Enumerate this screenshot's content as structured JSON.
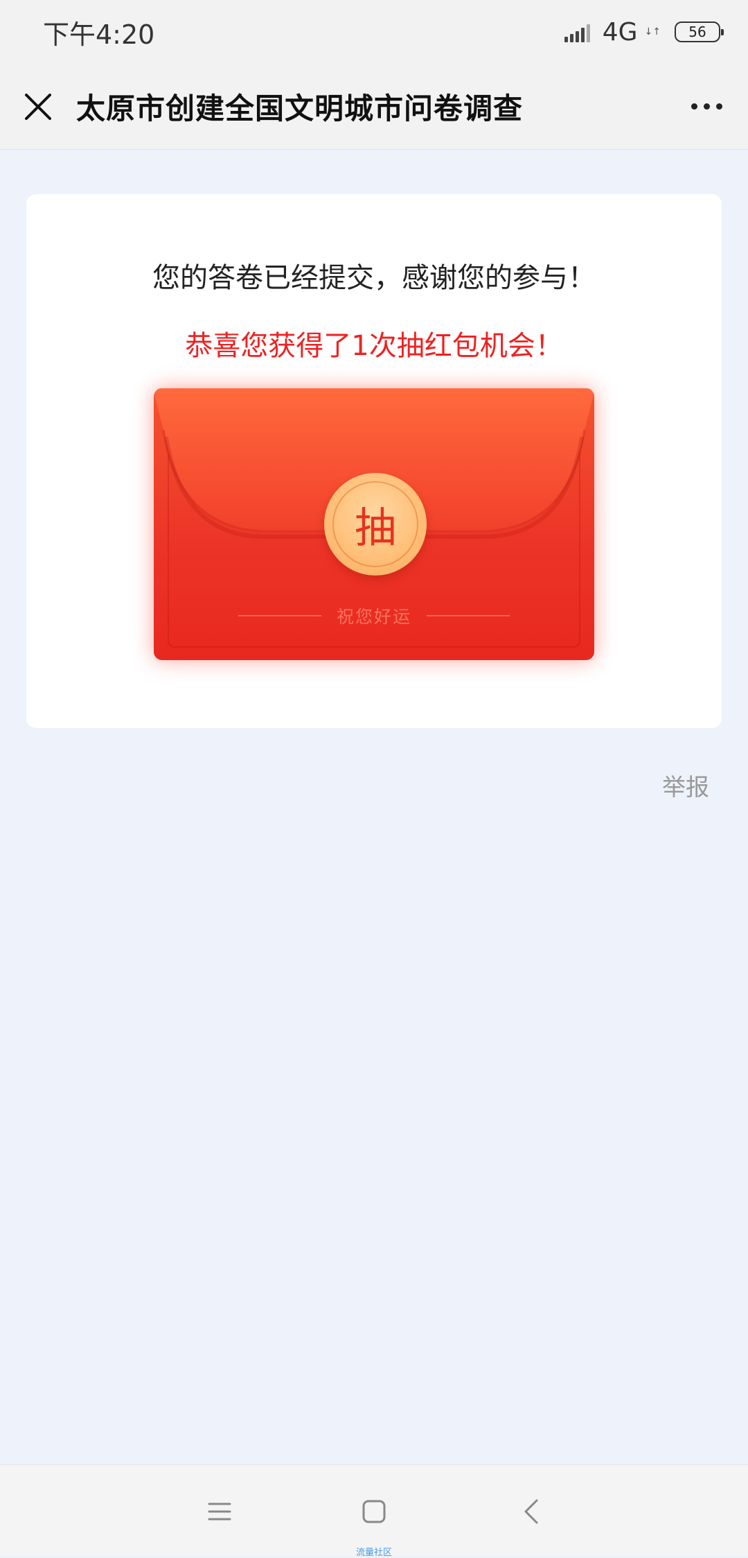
{
  "status_bar": {
    "time": "下午4:20",
    "network": "4G",
    "network_arrows": "↓↑",
    "battery": "56"
  },
  "nav": {
    "title": "太原市创建全国文明城市问卷调查",
    "close_icon": "close-icon",
    "more_icon": "more-icon"
  },
  "card": {
    "message": "您的答卷已经提交，感谢您的参与！",
    "reward_message": "恭喜您获得了1次抽红包机会！",
    "envelope": {
      "coin_label": "抽",
      "wish_text": "祝您好运"
    }
  },
  "report_label": "举报",
  "watermark": "流量社区",
  "colors": {
    "page_bg": "#eef2fb",
    "accent_red": "#ef2121",
    "envelope_red": "#ec3327",
    "coin_gold": "#ffc07a"
  }
}
